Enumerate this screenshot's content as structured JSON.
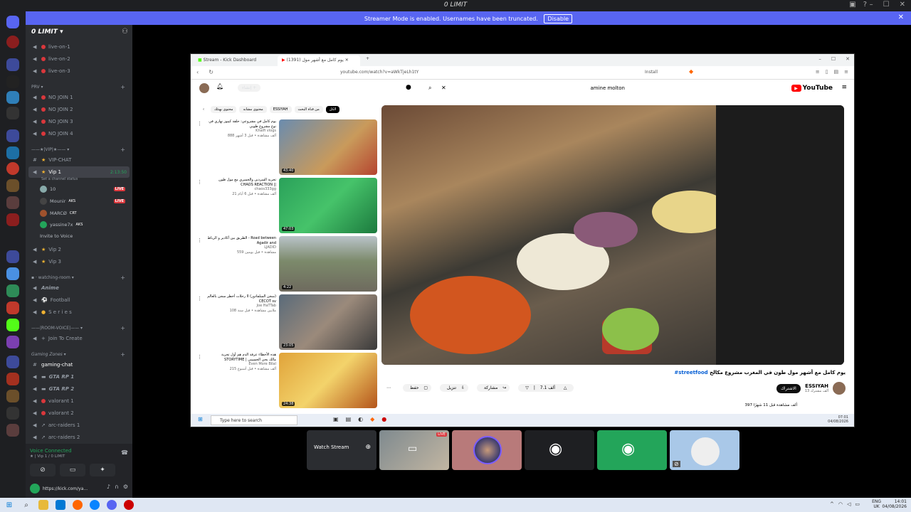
{
  "window": {
    "title": "0 LIMIT"
  },
  "notice": {
    "text": "Streamer Mode is enabled. Usernames have been truncated.",
    "button": "Disable"
  },
  "guild": {
    "name": "0 LIMIT"
  },
  "channels": {
    "live": [
      "live-on-1",
      "live-on-2",
      "live-on-3"
    ],
    "prv_category": "PRV",
    "nojoin": [
      "NO JOIN 1",
      "NO JOIN 2",
      "NO JOIN 3",
      "NO JOIN 4"
    ],
    "vip_category": "★|VIP|★",
    "vip_chat": "VIP-CHAT",
    "vip1": "Vip 1",
    "vip1_timer": "2:13:50",
    "vip1_status": "Set a channel status",
    "vip2": "Vip 2",
    "vip3": "Vip 3",
    "watching_category": "watching-room",
    "anime": "Anime",
    "football": "Football",
    "series": "S e r i e s",
    "roomvoice_category": "|ROOM-VOICE|",
    "join_to_create": "Join To Create",
    "gaming_category": "Gaming Zones",
    "gaming_chat": "gaming-chat",
    "gta1": "GTA RP 1",
    "gta2": "GTA RP 2",
    "val1": "valorant 1",
    "val2": "valorant 2",
    "arc1": "arc-raiders 1",
    "arc2": "arc-raiders 2"
  },
  "members": [
    {
      "name": "10",
      "badge": "LIVE"
    },
    {
      "name": "Mounir",
      "badge": "AKS"
    },
    {
      "name": "MARCØ",
      "badge": "CRT"
    },
    {
      "name": "yassine7x",
      "badge": "AKS"
    }
  ],
  "invite_voice": "Invite to Voice",
  "voice": {
    "status": "Voice Connected",
    "channel": "★ | Vip 1 / 0 LIMIT",
    "user": "https://kick.com/ya..."
  },
  "browser": {
    "tab1": "Stream - Kick Dashboard",
    "tab2": "(1391) يوم كامل مع أشهر مول",
    "url": "youtube.com/watch?v=aWkTjeLh1tY",
    "install": "Install"
  },
  "youtube": {
    "search_query": "amine molton",
    "create": "إنشاء",
    "logo": "YouTube",
    "chips": [
      "الكل",
      "من قناة البحث",
      "ESSIYAH",
      "محتوى مشابه",
      "محتوى بهنئك"
    ],
    "recs": [
      {
        "title": "يوم كامل في مشروعي: حلقة كيبوز نهاري في نوع مشروع طوبي",
        "channel": "Khalfi vlogs",
        "meta": "888 ألف مشاهدة • قبل 3 أشهر",
        "dur": "43:40"
      },
      {
        "title": "تجربة السردين والجمبري مع مول طون CHAOS REACTION ||",
        "channel": "chaos333gg",
        "meta": "21 ألف مشاهدة • قبل 6 أيام",
        "dur": "47:03"
      },
      {
        "title": "الطريق بين أكادير و الرباط - Road between Agadir and",
        "channel": "LJADID",
        "meta": "559 مشاهدة • قبل يومين",
        "dur": "4:22"
      },
      {
        "title": "رحلات أخطر سجن بالعالم II (سجن السلفادور) CECOT sv",
        "channel": "Joe HaTTab",
        "meta": "108 ملايين مشاهدة • قبل سنة",
        "dur": "23:05"
      },
      {
        "title": "هذه الأخطاء عرفة الدم هم أول تجربة STORYTIME | مالك بحي الحسيني",
        "channel": "Even More Bilal",
        "meta": "215 ألف مشاهدة • قبل أسبوع",
        "dur": "24:38"
      }
    ],
    "video_title": "يوم كامل مع أشهر مول طون في المغرب مشروع مكالح",
    "hashtag": "#streetfood",
    "channel": "ESSIYAH",
    "subs": "13 ألف مشترك",
    "subscribe": "الاشتراك",
    "likes": "7.1 ألف",
    "share": "مشاركة",
    "download": "تنزيل",
    "save": "حفظ",
    "views": "397 ألف مشاهدة قبل 11 شهرًا",
    "taskbar_search": "Type here to search",
    "tray_time": "07:01",
    "tray_date": "04/08/2026"
  },
  "tiles": {
    "watch_stream": "Watch Stream",
    "live": "LIVE"
  },
  "os_taskbar": {
    "time": "14:01",
    "date": "04/08/2026",
    "lang": "ENG",
    "region": "UK"
  },
  "colors": {
    "discord_blurple": "#5865f2",
    "live_red": "#da373c",
    "green": "#23a55a"
  }
}
